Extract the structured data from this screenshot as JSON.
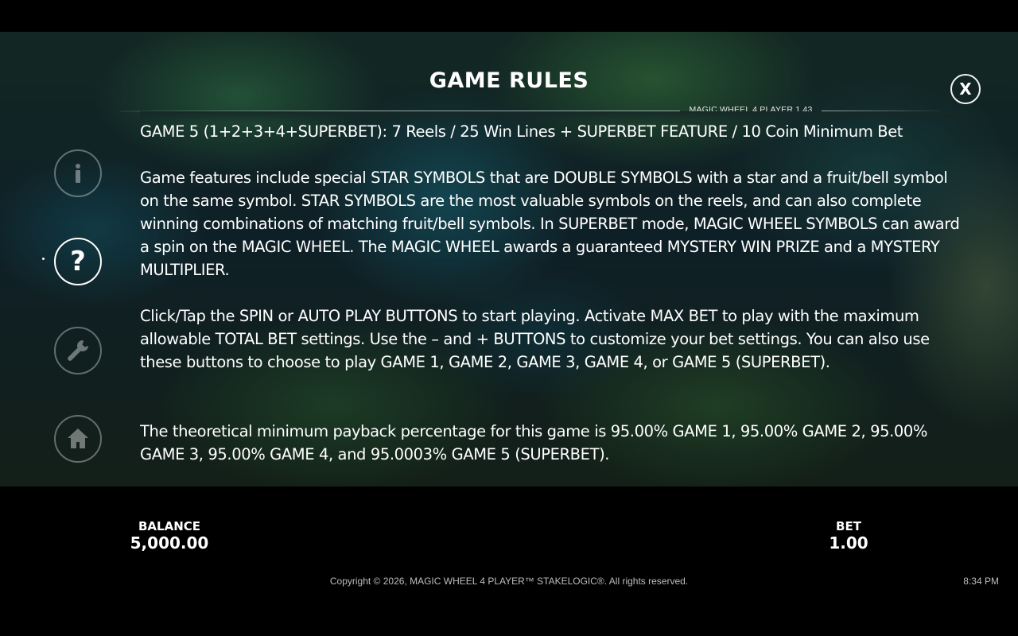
{
  "header": {
    "title": "GAME RULES",
    "version": "MAGIC WHEEL 4 PLAYER 1.43",
    "close_label": "X"
  },
  "sidebar": {
    "items": [
      {
        "name": "info",
        "glyph": "i",
        "active": false
      },
      {
        "name": "help",
        "glyph": "?",
        "active": true
      },
      {
        "name": "settings",
        "glyph": "wrench",
        "active": false
      },
      {
        "name": "home",
        "glyph": "house",
        "active": false
      }
    ]
  },
  "rules": {
    "clipped_line": "GAME 5 (1+2+3+4+SUPERBET): 7 Reels / 25 Win Lines + SUPERBET FEATURE / 10 Coin Minimum Bet",
    "paragraph_1": "Game features include special STAR SYMBOLS that are DOUBLE SYMBOLS with a star and a fruit/bell symbol on the same symbol. STAR SYMBOLS are the most valuable symbols on the reels, and can also complete winning combinations of matching fruit/bell symbols. In SUPERBET mode, MAGIC WHEEL SYMBOLS can award a spin on the MAGIC WHEEL. The MAGIC WHEEL awards a guaranteed MYSTERY WIN PRIZE and a MYSTERY MULTIPLIER.",
    "paragraph_2": "Click/Tap the SPIN or AUTO PLAY BUTTONS to start playing. Activate MAX BET to play with the maximum allowable TOTAL BET settings. Use the – and + BUTTONS to customize your bet settings. You can also use these buttons to choose to play GAME 1, GAME 2, GAME 3, GAME 4, or GAME 5 (SUPERBET).",
    "paragraph_3": "The theoretical minimum payback percentage for this game is 95.00% GAME 1, 95.00% GAME 2, 95.00% GAME 3, 95.00% GAME 4, and 95.0003% GAME 5 (SUPERBET)."
  },
  "footer": {
    "balance_label": "BALANCE",
    "balance_value": "5,000.00",
    "bet_label": "BET",
    "bet_value": "1.00",
    "copyright": "Copyright © 2026, MAGIC WHEEL 4 PLAYER™ STAKELOGIC®. All rights reserved.",
    "clock": "8:34 PM"
  }
}
